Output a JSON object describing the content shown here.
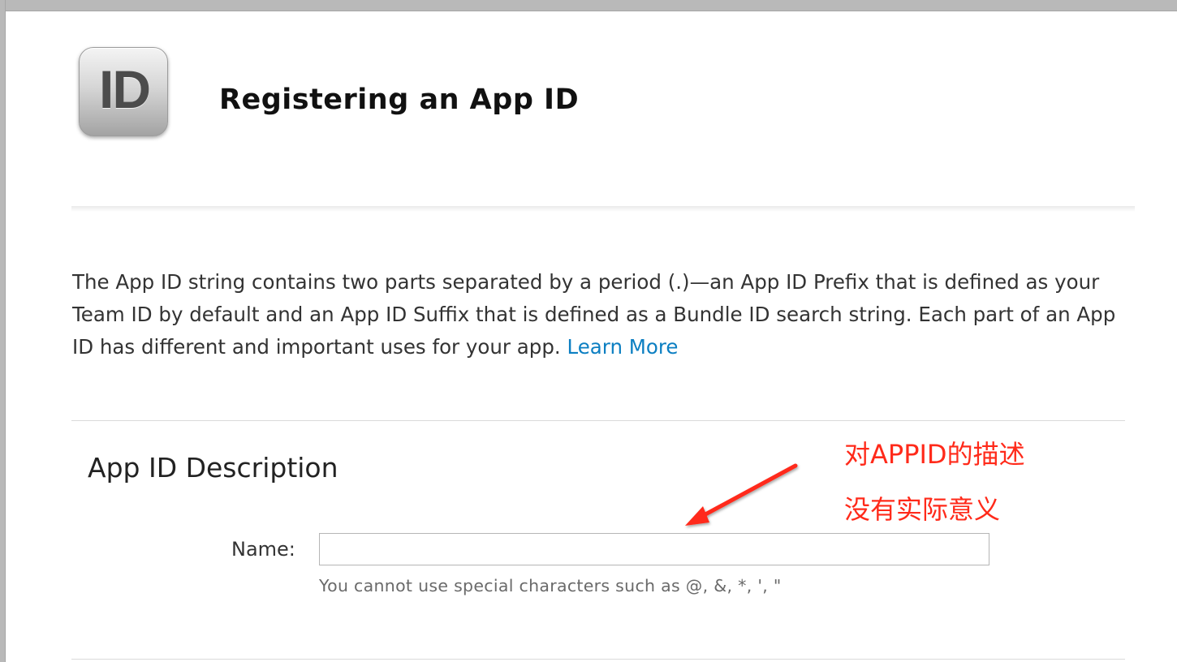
{
  "header": {
    "icon_text": "ID",
    "title": "Registering an App ID"
  },
  "intro": {
    "text": "The App ID string contains two parts separated by a period (.)—an App ID Prefix that is defined as your Team ID by default and an App ID Suffix that is defined as a Bundle ID search string. Each part of an App ID has different and important uses for your app.",
    "link_label": "Learn More"
  },
  "description_section": {
    "title": "App ID Description",
    "name_label": "Name:",
    "name_value": "",
    "name_hint": "You cannot use special characters such as @, &, *, ', \""
  },
  "annotation": {
    "line1": "对APPID的描述",
    "line2": "没有实际意义",
    "color": "#ff2a1a"
  },
  "colors": {
    "link": "#0c7fc2",
    "window_chrome": "#b9b9b9"
  }
}
